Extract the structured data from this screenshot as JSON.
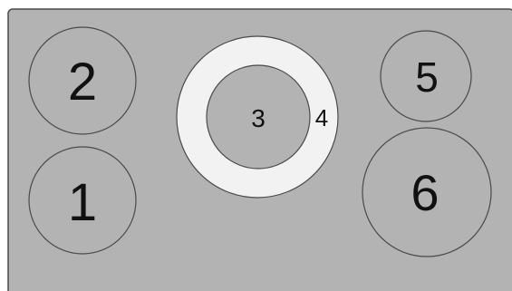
{
  "colors": {
    "surface": "#b3b3b3",
    "outline": "#4a4a4a",
    "ring": "#f2f2f2",
    "text": "#111111",
    "page": "#ffffff"
  },
  "zones": [
    {
      "id": "zone-1",
      "label": "1"
    },
    {
      "id": "zone-2",
      "label": "2"
    },
    {
      "id": "zone-3",
      "label": "3"
    },
    {
      "id": "zone-4",
      "label": "4"
    },
    {
      "id": "zone-5",
      "label": "5"
    },
    {
      "id": "zone-6",
      "label": "6"
    }
  ]
}
